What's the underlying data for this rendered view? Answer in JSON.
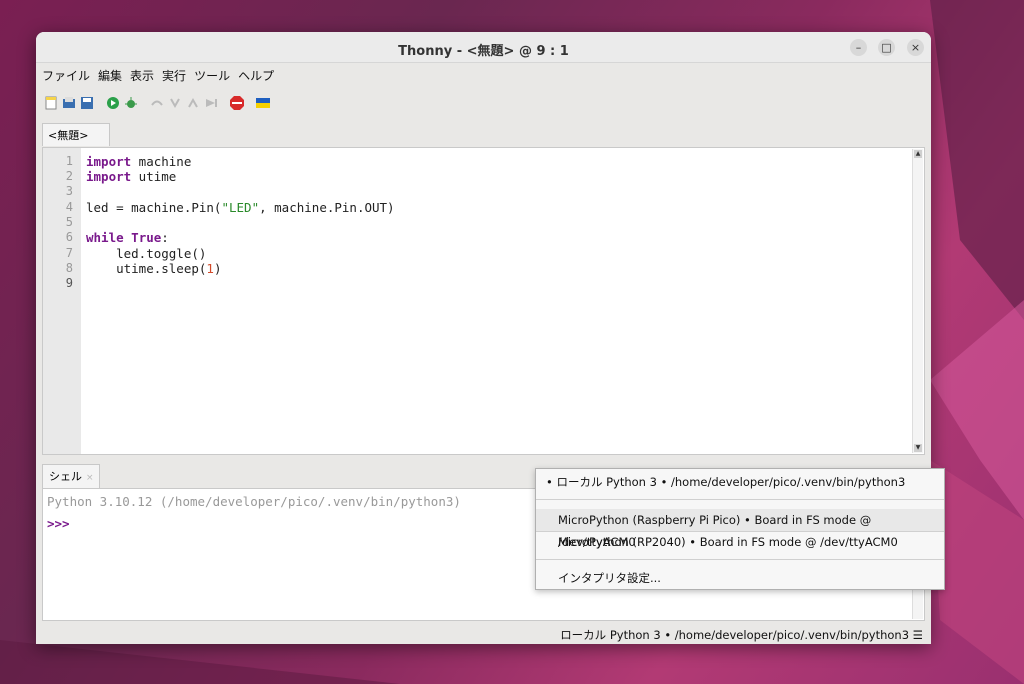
{
  "window": {
    "title": "Thonny  -  <無題>  @  9 : 1"
  },
  "menu": [
    "ファイル",
    "編集",
    "表示",
    "実行",
    "ツール",
    "ヘルプ"
  ],
  "toolbar": [
    "new-file-icon",
    "open-file-icon",
    "save-file-icon",
    "run-icon",
    "debug-icon",
    "step-over-icon",
    "step-into-icon",
    "step-out-icon",
    "resume-icon",
    "stop-icon",
    "ukraine-flag-icon"
  ],
  "editor": {
    "tab_label": "<無題> *",
    "tab_close": "×",
    "line_numbers": [
      "1",
      "2",
      "3",
      "4",
      "5",
      "6",
      "7",
      "8",
      "9"
    ],
    "code": {
      "l1_kw": "import",
      "l1_rest": " machine",
      "l2_kw": "import",
      "l2_rest": " utime",
      "l4_a": "led = machine.Pin(",
      "l4_str": "\"LED\"",
      "l4_b": ", machine.Pin.OUT)",
      "l6_kw1": "while",
      "l6_kw2": "True",
      "l6_colon": ":",
      "l7": "    led.toggle()",
      "l8_a": "    utime.sleep(",
      "l8_num": "1",
      "l8_b": ")"
    }
  },
  "shell": {
    "tab_label": "シェル",
    "tab_close": "×",
    "info": "Python 3.10.12 (/home/developer/pico/.venv/bin/python3)",
    "prompt": ">>>"
  },
  "interpreter_menu": {
    "items": [
      "•  ローカル Python 3  •  /home/developer/pico/.venv/bin/python3",
      "MicroPython (Raspberry Pi Pico)  •  Board in FS mode @ /dev/ttyACM0",
      "MicroPython (RP2040)  •  Board in FS mode @ /dev/ttyACM0",
      "インタプリタ設定..."
    ]
  },
  "status": {
    "interpreter": "ローカル Python 3  •  /home/developer/pico/.venv/bin/python3  ☰"
  },
  "colors": {
    "keyword": "#7a1a8c",
    "string": "#2a8a2a",
    "number": "#d24a2a",
    "prompt": "#7a1a8c"
  }
}
